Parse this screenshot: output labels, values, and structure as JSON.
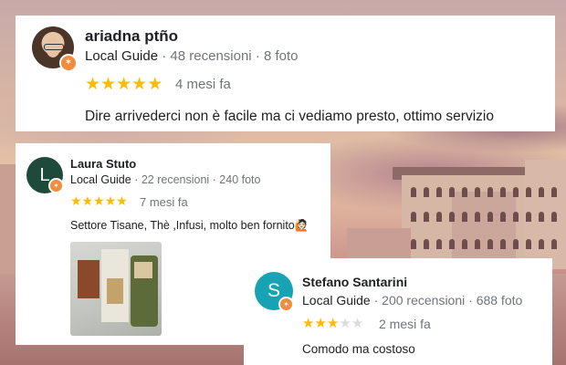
{
  "colors": {
    "star_filled": "#fbbc04",
    "star_empty": "#dadce0",
    "local_guide_badge": "#f28b3c",
    "meta_gray": "#70757a"
  },
  "reviews": [
    {
      "reviewer": "ariadna ptño",
      "avatar_type": "photo",
      "avatar_letter": "",
      "local_guide": "Local Guide",
      "review_count": "48 recensioni",
      "photo_count": "8 foto",
      "rating": 5,
      "max_rating": 5,
      "time_ago": "4 mesi fa",
      "text": "Dire arrivederci non è facile ma ci vediamo presto, ottimo servizio"
    },
    {
      "reviewer": "Laura Stuto",
      "avatar_type": "letter",
      "avatar_letter": "L",
      "local_guide": "Local Guide",
      "review_count": "22 recensioni",
      "photo_count": "240 foto",
      "rating": 5,
      "max_rating": 5,
      "time_ago": "7 mesi fa",
      "text": "Settore Tisane, Thè ,Infusi, molto ben fornito🙋🏻"
    },
    {
      "reviewer": "Stefano Santarini",
      "avatar_type": "letter",
      "avatar_letter": "S",
      "local_guide": "Local Guide",
      "review_count": "200 recensioni",
      "photo_count": "688 foto",
      "rating": 3,
      "max_rating": 5,
      "time_ago": "2 mesi fa",
      "text": "Comodo  ma costoso"
    }
  ],
  "icons": {
    "badge_icon": "local-guide-star-icon",
    "star_glyph": "★",
    "badge_glyph": "✶"
  },
  "separator": " · "
}
